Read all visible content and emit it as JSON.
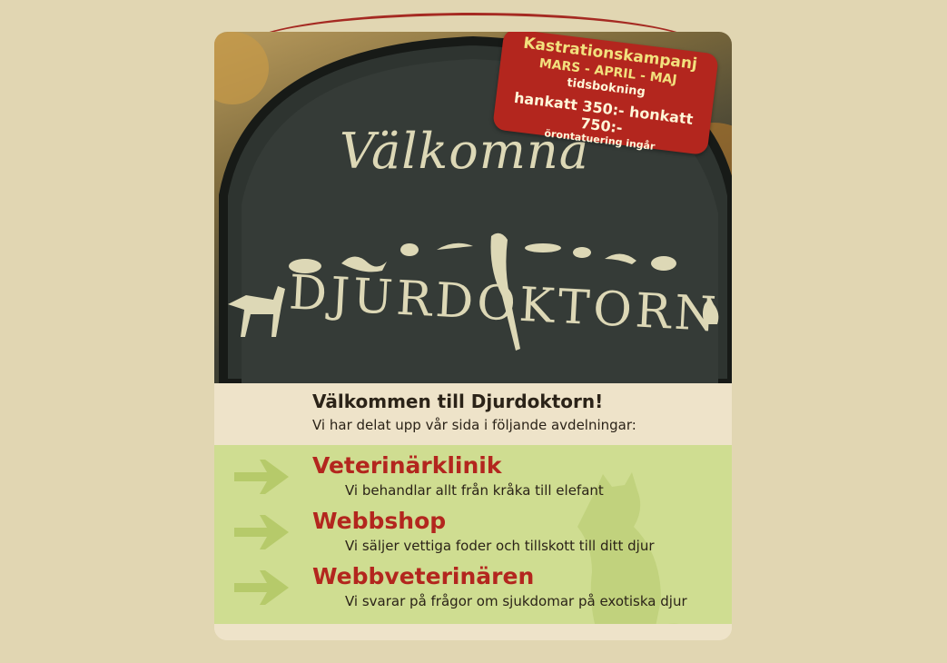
{
  "hero": {
    "sign_welcome": "Välkomna",
    "sign_brand": "DJURDOKTORN"
  },
  "promo": {
    "line1": "Kastrationskampanj",
    "line2": "MARS - APRIL - MAJ",
    "line3": "tidsbokning",
    "line4": "hankatt 350:- honkatt 750:-",
    "line5": "örontatuering ingår"
  },
  "intro": {
    "title": "Välkommen till Djurdoktorn!",
    "subtitle": "Vi har delat upp vår sida i följande avdelningar:"
  },
  "sections": [
    {
      "title": "Veterinärklinik",
      "desc": "Vi behandlar allt från kråka till elefant"
    },
    {
      "title": "Webbshop",
      "desc": "Vi säljer vettiga foder och tillskott till ditt djur"
    },
    {
      "title": "Webbveterinären",
      "desc": "Vi svarar på frågor om sjukdomar på exotiska djur"
    }
  ],
  "colors": {
    "background": "#e1d6b2",
    "accent_red": "#b3261e",
    "section_green": "#cfdd91",
    "arrow_green": "#b6ca6a"
  }
}
